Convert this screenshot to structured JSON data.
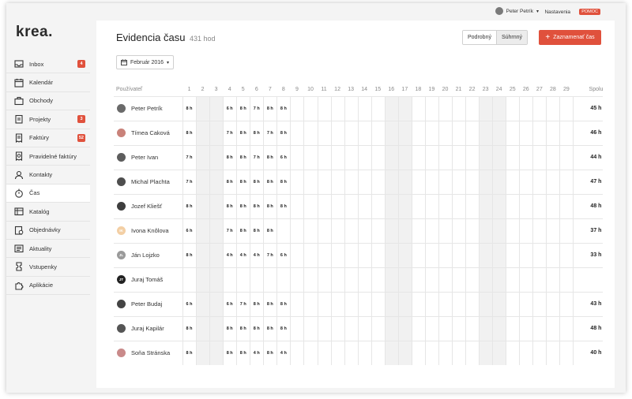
{
  "topbar": {
    "user_name": "Peter Petrík",
    "settings_label": "Nastavenia",
    "help_label": "POMOC"
  },
  "app": {
    "logo": "krea."
  },
  "sidebar": {
    "items": [
      {
        "label": "Inbox",
        "icon": "inbox-icon",
        "badge": "4"
      },
      {
        "label": "Kalendár",
        "icon": "calendar-icon",
        "badge": ""
      },
      {
        "label": "Obchody",
        "icon": "briefcase-icon",
        "badge": ""
      },
      {
        "label": "Projekty",
        "icon": "clipboard-icon",
        "badge": "3"
      },
      {
        "label": "Faktúry",
        "icon": "invoice-icon",
        "badge": "52"
      },
      {
        "label": "Pravidelné faktúry",
        "icon": "recurring-invoice-icon",
        "badge": ""
      },
      {
        "label": "Kontakty",
        "icon": "person-icon",
        "badge": ""
      },
      {
        "label": "Čas",
        "icon": "stopwatch-icon",
        "badge": "",
        "active": true
      },
      {
        "label": "Katalóg",
        "icon": "catalog-icon",
        "badge": ""
      },
      {
        "label": "Objednávky",
        "icon": "orders-icon",
        "badge": ""
      },
      {
        "label": "Aktuality",
        "icon": "news-icon",
        "badge": ""
      },
      {
        "label": "Vstupenky",
        "icon": "ticket-icon",
        "badge": ""
      },
      {
        "label": "Aplikácie",
        "icon": "puzzle-icon",
        "badge": ""
      }
    ]
  },
  "header": {
    "title": "Evidencia času",
    "total": "431 hod",
    "view_detailed": "Podrobný",
    "view_summary": "Súhrnný",
    "add_button": "Zaznamenať čas",
    "month": "Február 2016"
  },
  "table": {
    "user_header": "Používateľ",
    "total_header": "Spolu",
    "days": [
      "1",
      "2",
      "3",
      "4",
      "5",
      "6",
      "7",
      "8",
      "9",
      "10",
      "11",
      "12",
      "13",
      "14",
      "15",
      "16",
      "17",
      "18",
      "19",
      "20",
      "21",
      "22",
      "23",
      "24",
      "25",
      "26",
      "27",
      "28",
      "29"
    ],
    "weekend_days": [
      2,
      3,
      16,
      17,
      23,
      24
    ],
    "colors": {
      "weekend": "#f1f1f1",
      "accent": "#e0513c"
    },
    "rows": [
      {
        "name": "Peter Petrík",
        "avatar_color": "#6a6a6a",
        "initials": "",
        "total": "45 h",
        "hours": {
          "1": "8 h",
          "4": "6 h",
          "5": "8 h",
          "6": "7 h",
          "7": "8 h",
          "8": "8 h"
        }
      },
      {
        "name": "Tímea Caková",
        "avatar_color": "#c9827a",
        "initials": "",
        "total": "46 h",
        "hours": {
          "1": "8 h",
          "4": "7 h",
          "5": "8 h",
          "6": "8 h",
          "7": "7 h",
          "8": "8 h"
        }
      },
      {
        "name": "Peter Ivan",
        "avatar_color": "#5d5d5d",
        "initials": "",
        "total": "44 h",
        "hours": {
          "1": "7 h",
          "4": "8 h",
          "5": "8 h",
          "6": "7 h",
          "7": "8 h",
          "8": "6 h"
        }
      },
      {
        "name": "Michal Plachta",
        "avatar_color": "#4e4e4e",
        "initials": "",
        "total": "47 h",
        "hours": {
          "1": "7 h",
          "4": "8 h",
          "5": "8 h",
          "6": "8 h",
          "7": "8 h",
          "8": "8 h"
        }
      },
      {
        "name": "Jozef Kliešť",
        "avatar_color": "#3e3e3e",
        "initials": "",
        "total": "48 h",
        "hours": {
          "1": "8 h",
          "4": "8 h",
          "5": "8 h",
          "6": "8 h",
          "7": "8 h",
          "8": "8 h"
        }
      },
      {
        "name": "Ivona Knôlova",
        "avatar_color": "#f3cfa4",
        "initials": "IK",
        "total": "37 h",
        "hours": {
          "1": "6 h",
          "4": "7 h",
          "5": "8 h",
          "6": "8 h",
          "7": "8 h"
        }
      },
      {
        "name": "Ján Lojzko",
        "avatar_color": "#9a9a9a",
        "initials": "JL",
        "total": "33 h",
        "hours": {
          "1": "8 h",
          "4": "4 h",
          "5": "4 h",
          "6": "4 h",
          "7": "7 h",
          "8": "6 h"
        }
      },
      {
        "name": "Juraj Tomáš",
        "avatar_color": "#222222",
        "initials": "JT",
        "total": "",
        "hours": {}
      },
      {
        "name": "Peter Budaj",
        "avatar_color": "#444444",
        "initials": "",
        "total": "43 h",
        "hours": {
          "1": "6 h",
          "4": "6 h",
          "5": "7 h",
          "6": "8 h",
          "7": "8 h",
          "8": "8 h"
        }
      },
      {
        "name": "Juraj Kapilár",
        "avatar_color": "#555555",
        "initials": "",
        "total": "48 h",
        "hours": {
          "1": "8 h",
          "4": "8 h",
          "5": "8 h",
          "6": "8 h",
          "7": "8 h",
          "8": "8 h"
        }
      },
      {
        "name": "Soňa Stránska",
        "avatar_color": "#c98a8a",
        "initials": "",
        "total": "40 h",
        "hours": {
          "1": "8 h",
          "4": "8 h",
          "5": "8 h",
          "6": "4 h",
          "7": "8 h",
          "8": "4 h"
        }
      }
    ]
  }
}
